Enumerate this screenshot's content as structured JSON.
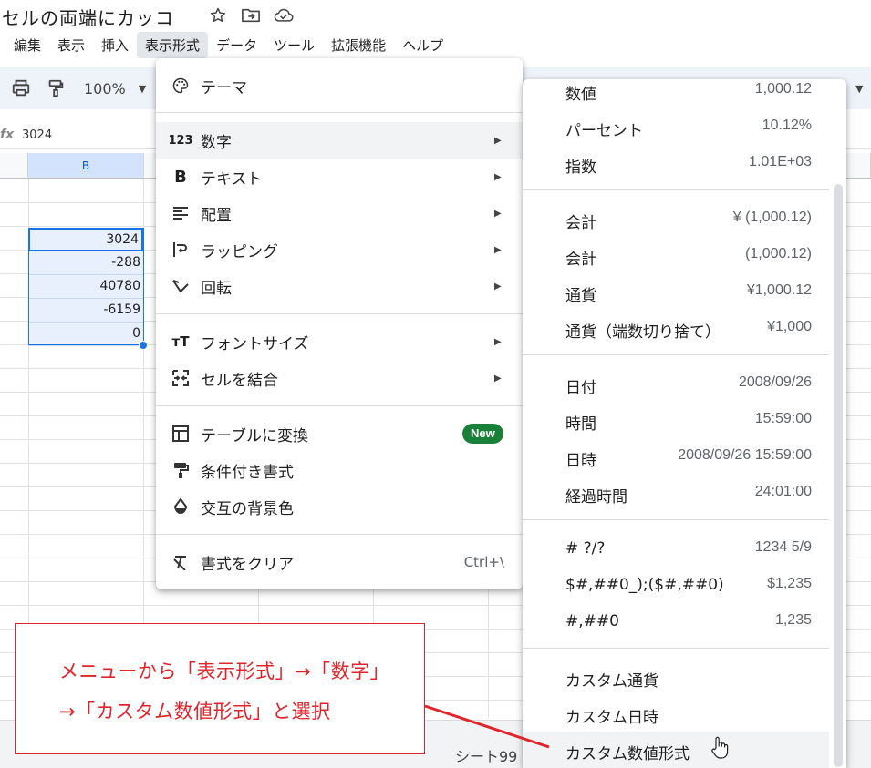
{
  "doc": {
    "title": "セルの両端にカッコ"
  },
  "title_icons": [
    "star-icon",
    "move-to-folder-icon",
    "cloud-saved-icon"
  ],
  "menubar": [
    "編集",
    "表示",
    "挿入",
    "表示形式",
    "データ",
    "ツール",
    "拡張機能",
    "ヘルプ"
  ],
  "toolbar": {
    "zoom": "100%"
  },
  "formula": {
    "fx": "fx",
    "value": "3024"
  },
  "grid": {
    "column": "B",
    "cells": [
      "3024",
      "-288",
      "40780",
      "-6159",
      "0"
    ]
  },
  "sheets": [
    "シート99"
  ],
  "menu": {
    "theme": "テーマ",
    "number": "数字",
    "text": "テキスト",
    "align": "配置",
    "wrap": "ラッピング",
    "rotate": "回転",
    "fontsize": "フォントサイズ",
    "merge": "セルを結合",
    "table": "テーブルに変換",
    "new_badge": "New",
    "conditional": "条件付き書式",
    "alternating": "交互の背景色",
    "clear": "書式をクリア",
    "clear_shortcut": "Ctrl+\\"
  },
  "submenu": {
    "groups": [
      [
        {
          "label": "数値",
          "value": "1,000.12"
        },
        {
          "label": "パーセント",
          "value": "10.12%"
        },
        {
          "label": "指数",
          "value": "1.01E+03"
        }
      ],
      [
        {
          "label": "会計",
          "value": "¥ (1,000.12)"
        },
        {
          "label": "会計",
          "value": "(1,000.12)"
        },
        {
          "label": "通貨",
          "value": "¥1,000.12"
        },
        {
          "label": "通貨（端数切り捨て）",
          "value": "¥1,000"
        }
      ],
      [
        {
          "label": "日付",
          "value": "2008/09/26"
        },
        {
          "label": "時間",
          "value": "15:59:00"
        },
        {
          "label": "日時",
          "value": "2008/09/26 15:59:00"
        },
        {
          "label": "経過時間",
          "value": "24:01:00"
        }
      ],
      [
        {
          "label": "# ?/?",
          "value": "1234 5/9"
        },
        {
          "label": "$#,##0_);($#,##0)",
          "value": "$1,235"
        },
        {
          "label": "#,##0",
          "value": "1,235"
        }
      ],
      [
        {
          "label": "カスタム通貨",
          "value": ""
        },
        {
          "label": "カスタム日時",
          "value": ""
        },
        {
          "label": "カスタム数値形式",
          "value": ""
        }
      ]
    ]
  },
  "annotation": {
    "line1": "メニューから「表示形式」→「数字」",
    "line2": "→「カスタム数値形式」と選択",
    "color": "#e0242b"
  }
}
